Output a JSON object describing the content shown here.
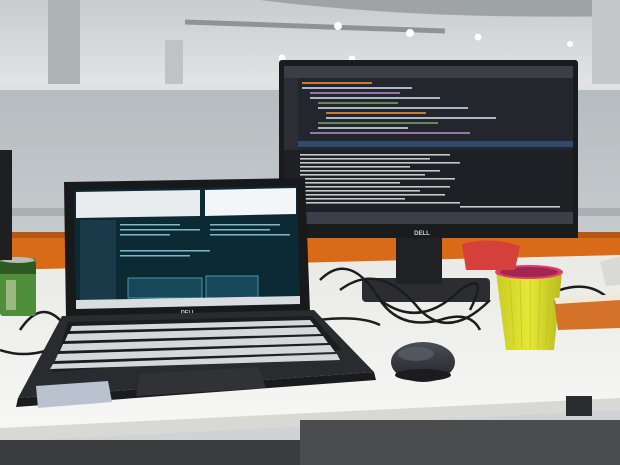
{
  "scene": {
    "monitor_brand": "DELL",
    "laptop_brand": "DELL",
    "colors": {
      "ceiling": "#d9dcdf",
      "wall": "#b9c0c3",
      "desk": "#f1f1ef",
      "orange_panel": "#d86a18",
      "ide_bg": "#23262d",
      "cup_yellow": "#d8d92a",
      "cup_rim": "#e23b6e",
      "notebook": "#d4722a",
      "mouse": "#35383d"
    }
  }
}
